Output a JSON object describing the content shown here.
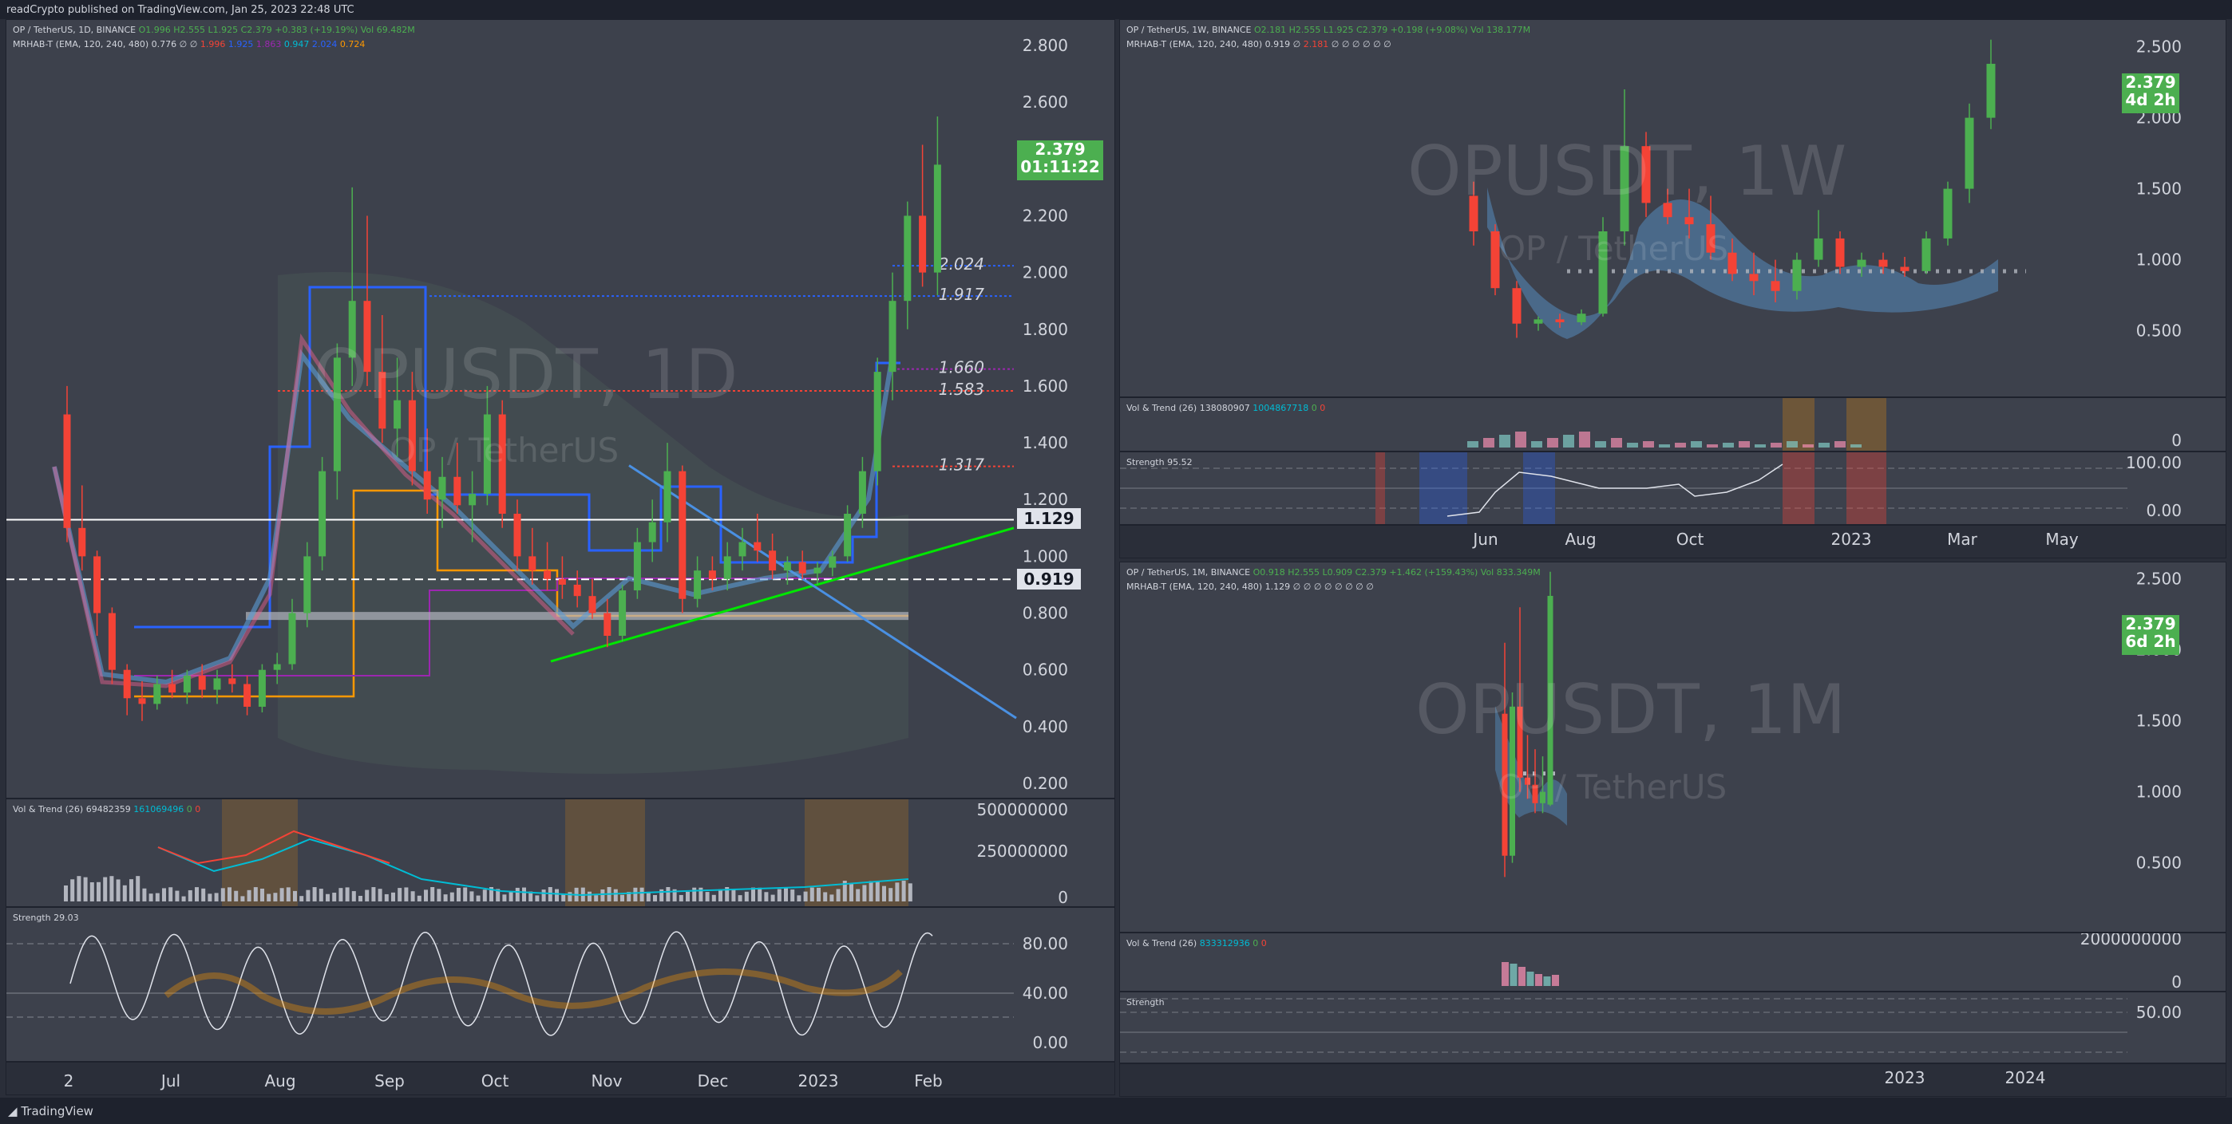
{
  "header": {
    "publish_note": "readCrypto published on TradingView.com, Jan 25, 2023 22:48 UTC"
  },
  "footer": {
    "brand": "TradingView"
  },
  "colors": {
    "up": "#4caf50",
    "down": "#f44336",
    "bg": "#3d414c",
    "frame": "#1e222d"
  },
  "daily": {
    "legend1": {
      "symbol": "OP / TetherUS, 1D, BINANCE",
      "o": "O1.996",
      "h": "H2.555",
      "l": "L1.925",
      "c": "C2.379",
      "chg": "+0.383 (+19.19%)",
      "vol": "Vol 69.482M"
    },
    "legend2": {
      "name": "MRHAB-T (EMA, 120, 240, 480)",
      "v1": "0.776",
      "v2": "∅",
      "v3": "∅",
      "v4": "1.996",
      "v5": "1.925",
      "v6": "1.863",
      "v7": "0.947",
      "v8": "2.024",
      "v9": "0.724"
    },
    "watermark": "OPUSDT, 1D",
    "watermark_sub": "OP / TetherUS",
    "price_ticks": [
      "2.800",
      "2.600",
      "2.400",
      "2.200",
      "2.000",
      "1.800",
      "1.600",
      "1.400",
      "1.200",
      "1.000",
      "0.800",
      "0.600",
      "0.400",
      "0.200"
    ],
    "last_price": "2.379",
    "countdown": "01:11:22",
    "level_1129": "1.129",
    "level_0919": "0.919",
    "level_labels": [
      "2.024",
      "1.917",
      "1.660",
      "1.583",
      "1.317"
    ],
    "vol_legend": {
      "name": "Vol & Trend (26)",
      "v1": "69482359",
      "v2": "161069496",
      "v3": "0",
      "v4": "0"
    },
    "vol_ticks": [
      "500000000",
      "250000000",
      "0"
    ],
    "strength_legend": {
      "name": "Strength",
      "value": "29.03"
    },
    "strength_ticks": [
      "80.00",
      "40.00",
      "0.00"
    ],
    "time_ticks": [
      "2",
      "Jul",
      "Aug",
      "Sep",
      "Oct",
      "Nov",
      "Dec",
      "2023",
      "Feb"
    ]
  },
  "weekly": {
    "legend1": {
      "symbol": "OP / TetherUS, 1W, BINANCE",
      "o": "O2.181",
      "h": "H2.555",
      "l": "L1.925",
      "c": "C2.379",
      "chg": "+0.198 (+9.08%)",
      "vol": "Vol 138.177M"
    },
    "legend2": {
      "name": "MRHAB-T (EMA, 120, 240, 480)",
      "v1": "0.919",
      "v2": "∅",
      "v3": "2.181",
      "rest": "∅ ∅ ∅ ∅ ∅ ∅"
    },
    "watermark": "OPUSDT, 1W",
    "watermark_sub": "OP / TetherUS",
    "price_ticks": [
      "2.500",
      "2.000",
      "1.500",
      "1.000",
      "0.500"
    ],
    "last_price": "2.379",
    "countdown": "4d 2h",
    "vol_legend": {
      "name": "Vol & Trend (26)",
      "v1": "138080907",
      "v2": "1004867718",
      "v3": "0",
      "v4": "0"
    },
    "vol_ticks": [
      "0"
    ],
    "strength_legend": {
      "name": "Strength",
      "value": "95.52"
    },
    "strength_ticks": [
      "100.00",
      "0.00"
    ],
    "time_ticks": [
      "Jun",
      "Aug",
      "Oct",
      "2023",
      "Mar",
      "May"
    ]
  },
  "monthly": {
    "legend1": {
      "symbol": "OP / TetherUS, 1M, BINANCE",
      "o": "O0.918",
      "h": "H2.555",
      "l": "L0.909",
      "c": "C2.379",
      "chg": "+1.462 (+159.43%)",
      "vol": "Vol 833.349M"
    },
    "legend2": {
      "name": "MRHAB-T (EMA, 120, 240, 480)",
      "v1": "1.129",
      "rest": "∅ ∅ ∅ ∅ ∅ ∅ ∅ ∅"
    },
    "watermark": "OPUSDT, 1M",
    "watermark_sub": "OP / TetherUS",
    "price_ticks": [
      "2.500",
      "2.000",
      "1.500",
      "1.000",
      "0.500"
    ],
    "last_price": "2.379",
    "countdown": "6d 2h",
    "vol_legend": {
      "name": "Vol & Trend (26)",
      "v1": "833312936",
      "v2": "0",
      "v3": "0"
    },
    "vol_ticks": [
      "2000000000",
      "0"
    ],
    "strength_legend": {
      "name": "Strength"
    },
    "strength_ticks": [
      "50.00"
    ],
    "time_ticks": [
      "2023",
      "2024"
    ]
  },
  "chart_data": [
    {
      "type": "candlestick",
      "title": "OPUSDT, 1D",
      "ylim": [
        0.2,
        2.8
      ],
      "candles": [
        [
          1.5,
          1.6,
          1.05,
          1.1
        ],
        [
          1.1,
          1.25,
          0.95,
          1.0
        ],
        [
          1.0,
          1.02,
          0.72,
          0.8
        ],
        [
          0.8,
          0.82,
          0.55,
          0.6
        ],
        [
          0.6,
          0.62,
          0.44,
          0.5
        ],
        [
          0.5,
          0.56,
          0.42,
          0.48
        ],
        [
          0.48,
          0.58,
          0.46,
          0.55
        ],
        [
          0.55,
          0.6,
          0.5,
          0.52
        ],
        [
          0.52,
          0.6,
          0.48,
          0.58
        ],
        [
          0.58,
          0.62,
          0.5,
          0.53
        ],
        [
          0.53,
          0.6,
          0.48,
          0.57
        ],
        [
          0.57,
          0.62,
          0.52,
          0.55
        ],
        [
          0.55,
          0.58,
          0.44,
          0.47
        ],
        [
          0.47,
          0.62,
          0.45,
          0.6
        ],
        [
          0.6,
          0.66,
          0.55,
          0.62
        ],
        [
          0.62,
          0.85,
          0.6,
          0.8
        ],
        [
          0.8,
          1.05,
          0.75,
          1.0
        ],
        [
          1.0,
          1.35,
          0.95,
          1.3
        ],
        [
          1.3,
          1.75,
          1.2,
          1.7
        ],
        [
          1.7,
          2.3,
          1.6,
          1.9
        ],
        [
          1.9,
          2.2,
          1.6,
          1.65
        ],
        [
          1.65,
          1.85,
          1.4,
          1.45
        ],
        [
          1.45,
          1.7,
          1.35,
          1.55
        ],
        [
          1.55,
          1.65,
          1.25,
          1.3
        ],
        [
          1.3,
          1.45,
          1.15,
          1.2
        ],
        [
          1.2,
          1.35,
          1.1,
          1.28
        ],
        [
          1.28,
          1.4,
          1.15,
          1.18
        ],
        [
          1.18,
          1.3,
          1.05,
          1.22
        ],
        [
          1.22,
          1.6,
          1.18,
          1.5
        ],
        [
          1.5,
          1.55,
          1.1,
          1.15
        ],
        [
          1.15,
          1.2,
          0.95,
          1.0
        ],
        [
          1.0,
          1.1,
          0.9,
          0.95
        ],
        [
          0.95,
          1.05,
          0.88,
          0.92
        ],
        [
          0.92,
          1.0,
          0.85,
          0.9
        ],
        [
          0.9,
          0.95,
          0.82,
          0.86
        ],
        [
          0.86,
          0.92,
          0.78,
          0.8
        ],
        [
          0.8,
          0.85,
          0.68,
          0.72
        ],
        [
          0.72,
          0.9,
          0.7,
          0.88
        ],
        [
          0.88,
          1.1,
          0.85,
          1.05
        ],
        [
          1.05,
          1.2,
          0.98,
          1.12
        ],
        [
          1.12,
          1.4,
          1.05,
          1.3
        ],
        [
          1.3,
          1.32,
          0.8,
          0.85
        ],
        [
          0.85,
          1.0,
          0.82,
          0.95
        ],
        [
          0.95,
          1.0,
          0.88,
          0.92
        ],
        [
          0.92,
          1.05,
          0.88,
          1.0
        ],
        [
          1.0,
          1.1,
          0.95,
          1.05
        ],
        [
          1.05,
          1.15,
          0.98,
          1.02
        ],
        [
          1.02,
          1.08,
          0.92,
          0.95
        ],
        [
          0.95,
          1.0,
          0.9,
          0.98
        ],
        [
          0.98,
          1.02,
          0.92,
          0.94
        ],
        [
          0.94,
          0.98,
          0.9,
          0.96
        ],
        [
          0.96,
          1.02,
          0.93,
          1.0
        ],
        [
          1.0,
          1.18,
          0.98,
          1.15
        ],
        [
          1.15,
          1.35,
          1.1,
          1.3
        ],
        [
          1.3,
          1.7,
          1.25,
          1.65
        ],
        [
          1.65,
          2.0,
          1.55,
          1.9
        ],
        [
          1.9,
          2.25,
          1.8,
          2.2
        ],
        [
          2.2,
          2.45,
          1.95,
          2.0
        ],
        [
          2.0,
          2.55,
          1.92,
          2.38
        ]
      ],
      "levels": [
        2.024,
        1.917,
        1.66,
        1.583,
        1.317,
        1.129,
        0.919
      ]
    },
    {
      "type": "candlestick",
      "title": "OPUSDT, 1W",
      "ylim": [
        0.2,
        2.7
      ],
      "candles": [
        [
          1.45,
          1.55,
          1.1,
          1.2
        ],
        [
          1.2,
          1.25,
          0.75,
          0.8
        ],
        [
          0.8,
          0.85,
          0.45,
          0.55
        ],
        [
          0.55,
          0.6,
          0.5,
          0.58
        ],
        [
          0.58,
          0.62,
          0.52,
          0.56
        ],
        [
          0.56,
          0.65,
          0.54,
          0.62
        ],
        [
          0.62,
          1.3,
          0.6,
          1.2
        ],
        [
          1.2,
          2.2,
          1.1,
          1.8
        ],
        [
          1.8,
          1.9,
          1.3,
          1.4
        ],
        [
          1.4,
          1.5,
          1.25,
          1.3
        ],
        [
          1.3,
          1.5,
          1.15,
          1.25
        ],
        [
          1.25,
          1.45,
          1.0,
          1.05
        ],
        [
          1.05,
          1.15,
          0.85,
          0.9
        ],
        [
          0.9,
          1.05,
          0.75,
          0.85
        ],
        [
          0.85,
          1.0,
          0.7,
          0.78
        ],
        [
          0.78,
          1.05,
          0.72,
          1.0
        ],
        [
          1.0,
          1.35,
          0.95,
          1.15
        ],
        [
          1.15,
          1.2,
          0.9,
          0.95
        ],
        [
          0.95,
          1.05,
          0.88,
          1.0
        ],
        [
          1.0,
          1.05,
          0.9,
          0.95
        ],
        [
          0.95,
          1.02,
          0.88,
          0.92
        ],
        [
          0.92,
          1.2,
          0.9,
          1.15
        ],
        [
          1.15,
          1.55,
          1.1,
          1.5
        ],
        [
          1.5,
          2.1,
          1.4,
          2.0
        ],
        [
          2.0,
          2.55,
          1.92,
          2.38
        ]
      ]
    },
    {
      "type": "candlestick",
      "title": "OPUSDT, 1M",
      "ylim": [
        0.2,
        2.7
      ],
      "candles": [
        [
          1.55,
          2.05,
          0.4,
          0.55
        ],
        [
          0.55,
          1.7,
          0.5,
          1.6
        ],
        [
          1.6,
          2.3,
          1.0,
          1.1
        ],
        [
          1.1,
          1.4,
          0.95,
          1.05
        ],
        [
          1.05,
          1.3,
          0.85,
          0.92
        ],
        [
          0.92,
          1.25,
          0.85,
          1.0
        ],
        [
          0.91,
          2.55,
          0.9,
          2.38
        ]
      ]
    }
  ]
}
